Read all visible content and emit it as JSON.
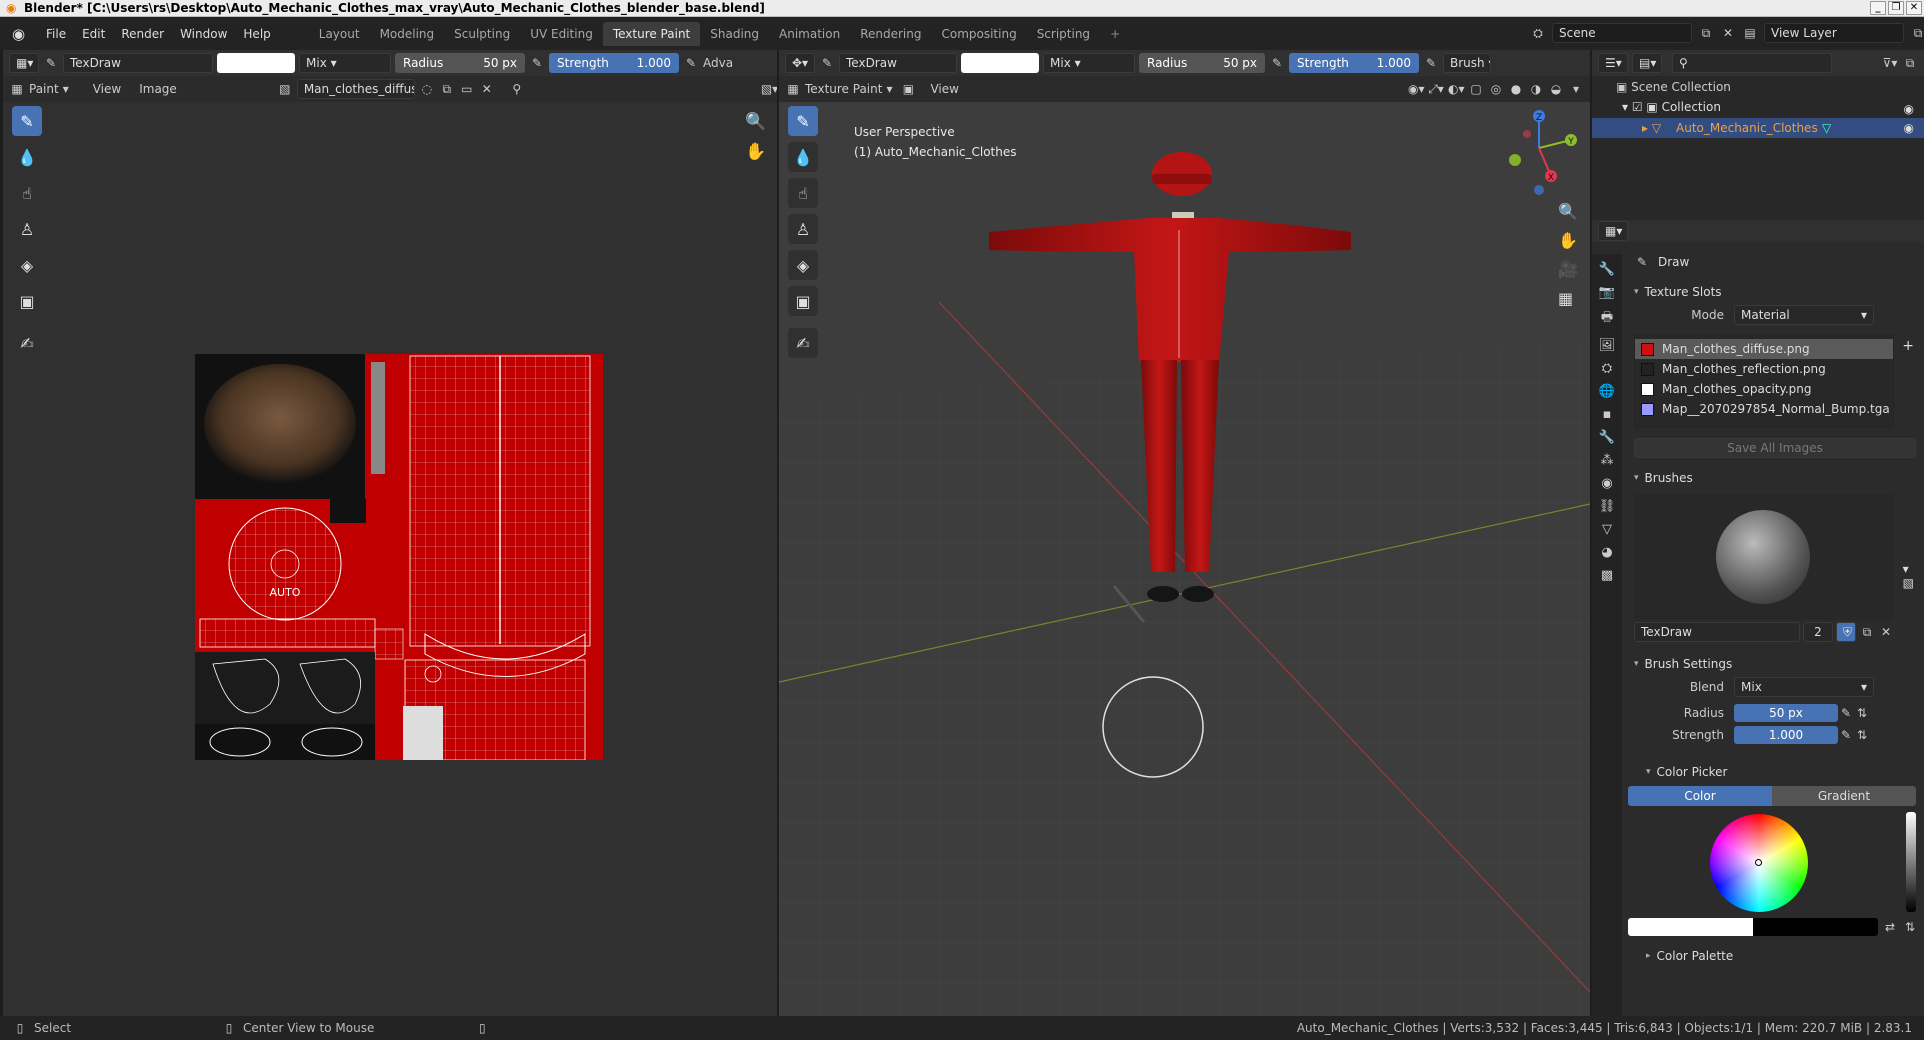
{
  "window": {
    "title": "Blender* [C:\\Users\\rs\\Desktop\\Auto_Mechanic_Clothes_max_vray\\Auto_Mechanic_Clothes_blender_base.blend]"
  },
  "menu": [
    "File",
    "Edit",
    "Render",
    "Window",
    "Help"
  ],
  "workspaces": [
    "Layout",
    "Modeling",
    "Sculpting",
    "UV Editing",
    "Texture Paint",
    "Shading",
    "Animation",
    "Rendering",
    "Compositing",
    "Scripting",
    "+"
  ],
  "scene": {
    "name": "Scene",
    "view_layer": "View Layer"
  },
  "image_editor": {
    "brush": "TexDraw",
    "blend": "Mix",
    "radius_label": "Radius",
    "radius": "50 px",
    "strength_label": "Strength",
    "strength": "1.000",
    "adv": "Adva",
    "mode": "Paint",
    "menus": [
      "View",
      "Image"
    ],
    "image_name": "Man_clothes_diffuse...",
    "uv_label": "AUTO"
  },
  "viewport": {
    "brush": "TexDraw",
    "blend": "Mix",
    "radius_label": "Radius",
    "radius": "50 px",
    "strength_label": "Strength",
    "strength": "1.000",
    "brush_menu": "Brush",
    "mode": "Texture Paint",
    "menus": [
      "View"
    ],
    "perspective": "User Perspective",
    "object": "(1) Auto_Mechanic_Clothes",
    "gizmo": {
      "x": "X",
      "y": "Y",
      "z": "Z"
    }
  },
  "outliner": {
    "root": "Scene Collection",
    "collection": "Collection",
    "object": "Auto_Mechanic_Clothes"
  },
  "properties": {
    "tool": "Draw",
    "texture_slots": {
      "title": "Texture Slots",
      "mode_label": "Mode",
      "mode": "Material",
      "slots": [
        {
          "name": "Man_clothes_diffuse.png",
          "color": "#cc1111"
        },
        {
          "name": "Man_clothes_reflection.png",
          "color": "#222222"
        },
        {
          "name": "Man_clothes_opacity.png",
          "color": "#ffffff"
        },
        {
          "name": "Map__2070297854_Normal_Bump.tga",
          "color": "#9a9aff"
        }
      ],
      "save_all": "Save All Images"
    },
    "brushes": {
      "title": "Brushes",
      "name": "TexDraw",
      "users": "2"
    },
    "brush_settings": {
      "title": "Brush Settings",
      "blend_label": "Blend",
      "blend": "Mix",
      "radius_label": "Radius",
      "radius": "50 px",
      "strength_label": "Strength",
      "strength": "1.000"
    },
    "color_picker": {
      "title": "Color Picker",
      "tab_color": "Color",
      "tab_gradient": "Gradient"
    },
    "color_palette": {
      "title": "Color Palette"
    }
  },
  "status": {
    "select": "Select",
    "center": "Center View to Mouse",
    "stats": "Auto_Mechanic_Clothes | Verts:3,532 | Faces:3,445 | Tris:6,843 | Objects:1/1 | Mem: 220.7 MiB | 2.83.1"
  },
  "colors": {
    "accent": "#4772b3",
    "cloth": "#b31212",
    "bg": "#303030"
  }
}
